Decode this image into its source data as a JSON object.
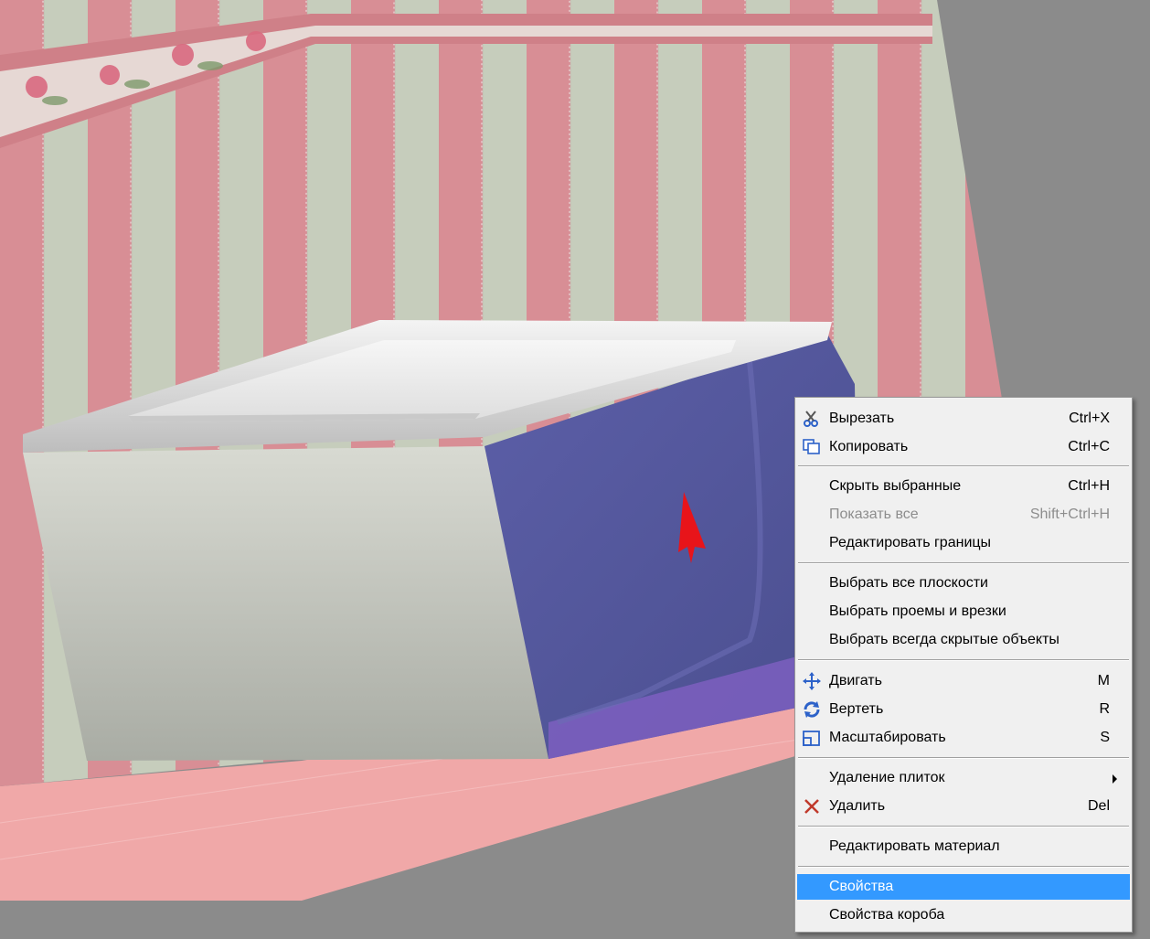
{
  "context_menu": {
    "items": [
      {
        "label": "Вырезать",
        "shortcut": "Ctrl+X",
        "icon": "scissors-icon"
      },
      {
        "label": "Копировать",
        "shortcut": "Ctrl+C",
        "icon": "copy-icon"
      },
      {
        "label": "Скрыть выбранные",
        "shortcut": "Ctrl+H"
      },
      {
        "label": "Показать все",
        "shortcut": "Shift+Ctrl+H",
        "disabled": true
      },
      {
        "label": "Редактировать границы",
        "shortcut": ""
      },
      {
        "label": "Выбрать все плоскости",
        "shortcut": ""
      },
      {
        "label": "Выбрать проемы и врезки",
        "shortcut": ""
      },
      {
        "label": "Выбрать всегда скрытые объекты",
        "shortcut": ""
      },
      {
        "label": "Двигать",
        "shortcut": "M",
        "icon": "move-arrows-icon"
      },
      {
        "label": "Вертеть",
        "shortcut": "R",
        "icon": "rotate-icon"
      },
      {
        "label": "Масштабировать",
        "shortcut": "S",
        "icon": "scale-icon"
      },
      {
        "label": "Удаление плиток",
        "shortcut": "",
        "submenu": true
      },
      {
        "label": "Удалить",
        "shortcut": "Del",
        "icon": "delete-x-icon"
      },
      {
        "label": "Редактировать материал",
        "shortcut": ""
      },
      {
        "label": "Свойства",
        "shortcut": "",
        "selected": true
      },
      {
        "label": "Свойства короба",
        "shortcut": ""
      }
    ],
    "selected_color": "#3399ff"
  },
  "scene": {
    "wall_colors": {
      "pink": "#d88e95",
      "sage": "#c6cdbc"
    },
    "floor_color": "#f0a8a8",
    "panel_color": "#5b5ea6",
    "bathtub_color": "#dcdcdc",
    "cursor_color": "#e8141a"
  }
}
